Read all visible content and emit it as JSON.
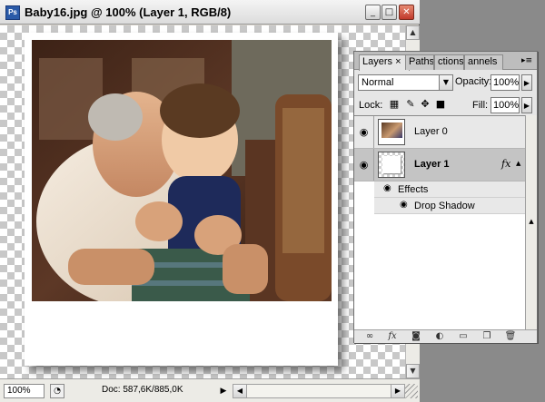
{
  "window": {
    "title": "Baby16.jpg @ 100% (Layer 1, RGB/8)",
    "app_icon": "Ps",
    "minimize_icon": "_",
    "maximize_icon": "□",
    "close_icon": "✕"
  },
  "status": {
    "zoom": "100%",
    "doc_info": "Doc: 587,6K/885,0K"
  },
  "layers_panel": {
    "tabs": {
      "layers": "Layers ×",
      "paths": "Paths",
      "actions": "ctions",
      "channels": "annels"
    },
    "blend_mode": "Normal",
    "opacity_label": "Opacity:",
    "opacity_value": "100%",
    "lock_label": "Lock:",
    "fill_label": "Fill:",
    "fill_value": "100%",
    "layers": [
      {
        "name": "Layer 0",
        "visible": true,
        "selected": false
      },
      {
        "name": "Layer 1",
        "visible": true,
        "selected": true,
        "fx": "fx"
      }
    ],
    "effects_label": "Effects",
    "drop_shadow_label": "Drop Shadow",
    "footer_fx": "fx"
  }
}
